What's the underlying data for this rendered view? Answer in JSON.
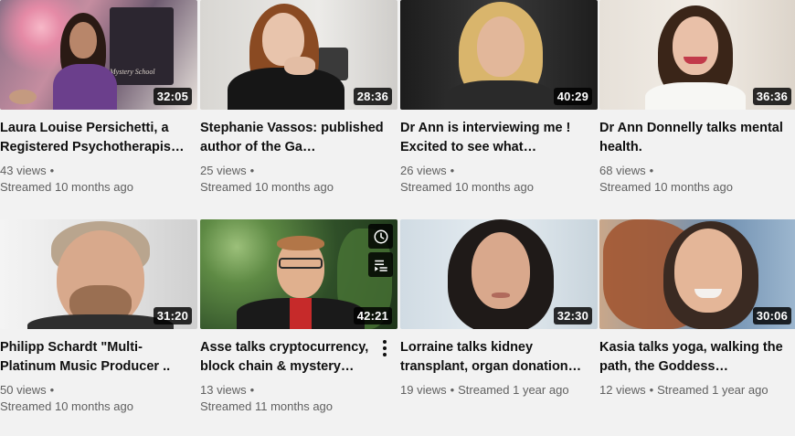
{
  "videos": [
    {
      "title": "Laura Louise Persichetti, a Registered Psychotherapis…",
      "views": "43 views",
      "streamed": "Streamed 10 months ago",
      "duration": "32:05",
      "thumb_text": "Mystery School"
    },
    {
      "title": "Stephanie Vassos: published author of the Ga…",
      "views": "25 views",
      "streamed": "Streamed 10 months ago",
      "duration": "28:36"
    },
    {
      "title": "Dr Ann is interviewing me ! Excited to see what…",
      "views": "26 views",
      "streamed": "Streamed 10 months ago",
      "duration": "40:29"
    },
    {
      "title": "Dr Ann Donnelly talks mental health.",
      "views": "68 views",
      "streamed": "Streamed 10 months ago",
      "duration": "36:36"
    },
    {
      "title": "Philipp Schardt \"Multi-Platinum Music Producer ..",
      "views": "50 views",
      "streamed": "Streamed 10 months ago",
      "duration": "31:20"
    },
    {
      "title": "Asse talks cryptocurrency, block chain & mystery…",
      "views": "13 views",
      "streamed": "Streamed 11 months ago",
      "duration": "42:21"
    },
    {
      "title": "Lorraine talks kidney transplant, organ donation…",
      "views": "19 views",
      "streamed": "Streamed 1 year ago",
      "duration": "32:30"
    },
    {
      "title": "Kasia talks yoga, walking the path, the Goddess…",
      "views": "12 views",
      "streamed": "Streamed 1 year ago",
      "duration": "30:06"
    }
  ],
  "icons": {
    "watch_later": "clock-icon",
    "add_to_queue": "add-to-queue-icon",
    "more": "more-vert-icon"
  },
  "colors": {
    "background": "#f2f2f2",
    "title": "#0f0f0f",
    "meta": "#606060",
    "badge_bg": "#000000"
  }
}
